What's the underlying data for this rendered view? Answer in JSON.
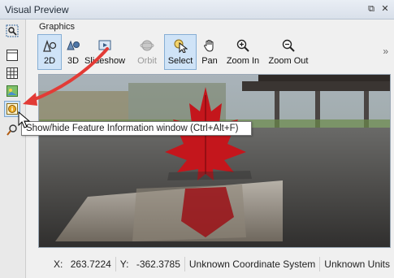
{
  "window": {
    "title": "Visual Preview",
    "buttons": [
      {
        "icon": "restore-icon",
        "glyph": "⧉"
      },
      {
        "icon": "close-icon",
        "glyph": "✕"
      }
    ]
  },
  "ribbon": {
    "group_label": "Graphics",
    "buttons": [
      {
        "name": "2d-button",
        "label": "2D",
        "icon": "2d-shapes-icon",
        "state": "active"
      },
      {
        "name": "3d-button",
        "label": "3D",
        "icon": "3d-shapes-icon",
        "state": "normal"
      },
      {
        "name": "slideshow-button",
        "label": "Slideshow",
        "icon": "slideshow-icon",
        "state": "normal"
      },
      {
        "name": "orbit-button",
        "label": "Orbit",
        "icon": "orbit-icon",
        "state": "disabled"
      },
      {
        "name": "select-button",
        "label": "Select",
        "icon": "select-cursor-icon",
        "state": "active"
      },
      {
        "name": "pan-button",
        "label": "Pan",
        "icon": "hand-icon",
        "state": "normal"
      },
      {
        "name": "zoom-in-button",
        "label": "Zoom In",
        "icon": "zoom-in-icon",
        "state": "normal"
      },
      {
        "name": "zoom-out-button",
        "label": "Zoom Out",
        "icon": "zoom-out-icon",
        "state": "normal"
      }
    ],
    "overflow_glyph": "»"
  },
  "sidebar": {
    "items": [
      {
        "icon": "zoom-extents-icon"
      },
      {
        "icon": "window-layout-icon"
      },
      {
        "icon": "grid-table-icon"
      },
      {
        "icon": "map-layers-icon"
      },
      {
        "icon": "feature-info-icon",
        "state": "active"
      },
      {
        "icon": "identify-tool-icon"
      }
    ]
  },
  "tooltip": {
    "text": "Show/hide Feature Information window (Ctrl+Alt+F)"
  },
  "status": {
    "x_label": "X:",
    "x_value": "263.7224",
    "y_label": "Y:",
    "y_value": "-362.3785",
    "crs": "Unknown Coordinate System",
    "units": "Unknown Units"
  },
  "colors": {
    "accent_active": "#cfe3f7",
    "annotation_arrow": "#e23b36",
    "leaf": "#c4161c"
  }
}
